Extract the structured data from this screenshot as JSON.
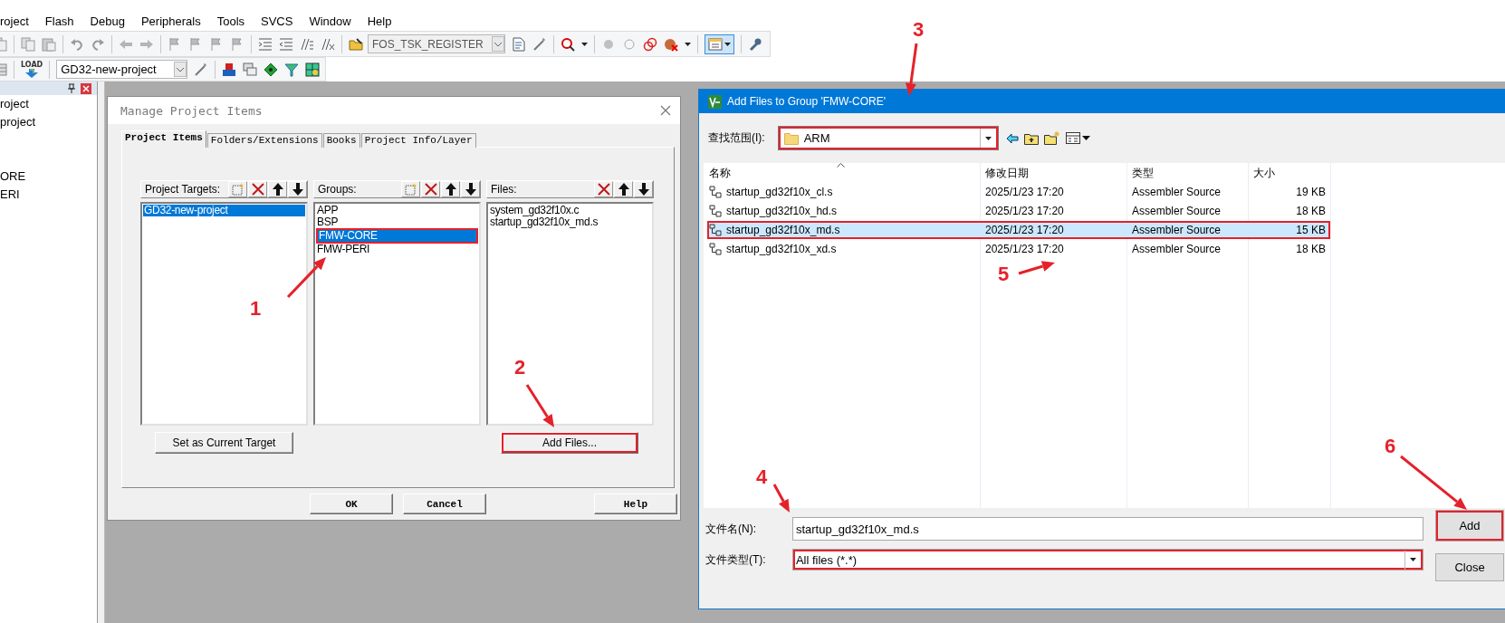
{
  "menu_bar": [
    "roject",
    "Flash",
    "Debug",
    "Peripherals",
    "Tools",
    "SVCS",
    "Window",
    "Help"
  ],
  "toolbar_1": {
    "target_combo": "FOS_TSK_REGISTER"
  },
  "toolbar_2": {
    "load_label": "LOAD",
    "project_combo": "GD32-new-project"
  },
  "project_panel": {
    "items": [
      {
        "label": "roject"
      },
      {
        "label": "project"
      },
      {
        "label": "ORE"
      },
      {
        "label": "ERI"
      }
    ]
  },
  "manage_dialog": {
    "title": "Manage Project Items",
    "tabs": [
      {
        "label": "Project Items",
        "selected": true
      },
      {
        "label": "Folders/Extensions",
        "selected": false
      },
      {
        "label": "Books",
        "selected": false
      },
      {
        "label": "Project Info/Layer",
        "selected": false
      }
    ],
    "lists": [
      {
        "header": "Project Targets:",
        "items": [
          {
            "label": "GD32-new-project",
            "selected": true,
            "highlighted": false
          }
        ]
      },
      {
        "header": "Groups:",
        "items": [
          {
            "label": "APP",
            "selected": false,
            "highlighted": false
          },
          {
            "label": "BSP",
            "selected": false,
            "highlighted": false
          },
          {
            "label": "FMW-CORE",
            "selected": true,
            "highlighted": true
          },
          {
            "label": "FMW-PERI",
            "selected": false,
            "highlighted": false
          }
        ]
      },
      {
        "header": "Files:",
        "items": [
          {
            "label": "system_gd32f10x.c",
            "selected": false,
            "highlighted": false
          },
          {
            "label": "startup_gd32f10x_md.s",
            "selected": false,
            "highlighted": false
          }
        ]
      }
    ],
    "panel_buttons": [
      {
        "label": "Set as Current Target",
        "highlighted": false
      },
      {
        "label": "Add Files...",
        "highlighted": true
      }
    ],
    "footer_buttons": [
      "OK",
      "Cancel",
      "Help"
    ]
  },
  "add_files_dialog": {
    "title": "Add Files to Group 'FMW-CORE'",
    "look_in": {
      "label": "查找范围(I):",
      "value": "ARM",
      "highlighted": true
    },
    "columns": [
      "名称",
      "修改日期",
      "类型",
      "大小"
    ],
    "files": [
      {
        "name": "startup_gd32f10x_cl.s",
        "modified": "2025/1/23 17:20",
        "type": "Assembler Source",
        "size": "19 KB",
        "selected": false,
        "highlighted": false
      },
      {
        "name": "startup_gd32f10x_hd.s",
        "modified": "2025/1/23 17:20",
        "type": "Assembler Source",
        "size": "18 KB",
        "selected": false,
        "highlighted": false
      },
      {
        "name": "startup_gd32f10x_md.s",
        "modified": "2025/1/23 17:20",
        "type": "Assembler Source",
        "size": "15 KB",
        "selected": true,
        "highlighted": true
      },
      {
        "name": "startup_gd32f10x_xd.s",
        "modified": "2025/1/23 17:20",
        "type": "Assembler Source",
        "size": "18 KB",
        "selected": false,
        "highlighted": false
      }
    ],
    "file_name": {
      "label": "文件名(N):",
      "value": "startup_gd32f10x_md.s"
    },
    "file_type": {
      "label": "文件类型(T):",
      "value": "All files (*.*)",
      "highlighted": true
    },
    "buttons": [
      {
        "label": "Add",
        "highlighted": true
      },
      {
        "label": "Close",
        "highlighted": false
      }
    ]
  },
  "annotations": [
    {
      "label": "1"
    },
    {
      "label": "2"
    },
    {
      "label": "3"
    },
    {
      "label": "4"
    },
    {
      "label": "5"
    },
    {
      "label": "6"
    }
  ]
}
